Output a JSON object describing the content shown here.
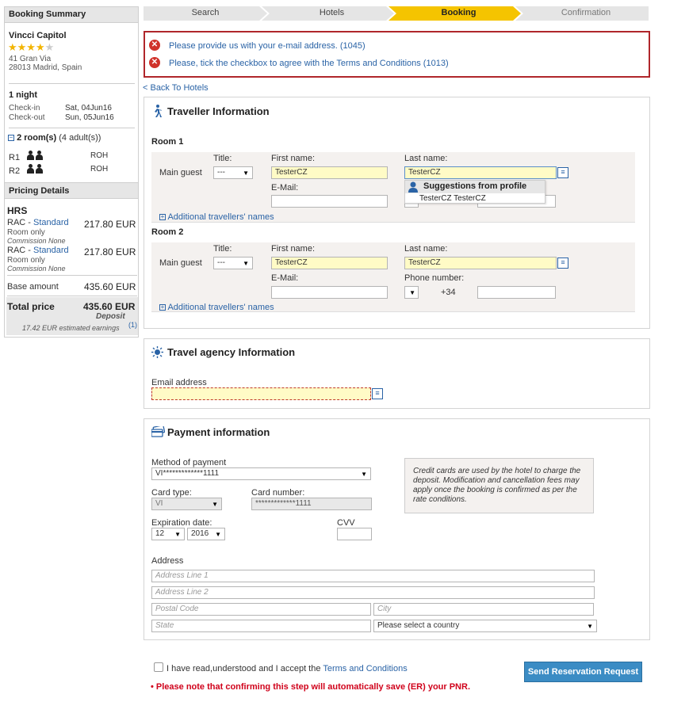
{
  "steps": [
    "Search",
    "Hotels",
    "Booking",
    "Confirmation"
  ],
  "summary": {
    "title": "Booking Summary",
    "hotel_name": "Vincci Capitol",
    "stars": "★★★★",
    "star_empty": "★",
    "address1": "41 Gran Via",
    "address2": "28013 Madrid, Spain",
    "nights": "1 night",
    "checkin_label": "Check-in",
    "checkin_value": "Sat, 04Jun16",
    "checkout_label": "Check-out",
    "checkout_value": "Sun, 05Jun16",
    "rooms_label": "2 room(s)",
    "rooms_adults": "(4 adult(s))",
    "rooms": [
      {
        "id": "R1",
        "code": "ROH"
      },
      {
        "id": "R2",
        "code": "ROH"
      }
    ]
  },
  "pricing": {
    "title": "Pricing Details",
    "provider": "HRS",
    "rates": [
      {
        "code": "RAC",
        "sep": " - ",
        "type": "Standard",
        "board": "Room only",
        "commission": "Commission None",
        "price": "217.80 EUR"
      },
      {
        "code": "RAC",
        "sep": " - ",
        "type": "Standard",
        "board": "Room only",
        "commission": "Commission None",
        "price": "217.80 EUR"
      }
    ],
    "base_label": "Base amount",
    "base_value": "435.60 EUR",
    "total_label": "Total price",
    "total_value": "435.60 EUR",
    "deposit": "Deposit",
    "earnings": "17.42 EUR estimated earnings",
    "earnings_note": "(1)"
  },
  "errors": [
    "Please provide us with your e-mail address. (1045)",
    "Please, tick the checkbox to agree with the Terms and Conditions (1013)"
  ],
  "back_link": "< Back To Hotels",
  "traveller": {
    "title": "Traveller Information",
    "main_guest": "Main guest",
    "title_label": "Title:",
    "first_label": "First name:",
    "last_label": "Last name:",
    "email_label": "E-Mail:",
    "phone_label": "Phone number:",
    "title_value": "---",
    "phone_code": "+34",
    "additional": "Additional travellers' names",
    "rooms": [
      {
        "label": "Room 1",
        "first": "TesterCZ",
        "last": "TesterCZ"
      },
      {
        "label": "Room 2",
        "first": "TesterCZ",
        "last": "TesterCZ"
      }
    ],
    "suggest_header": "Suggestions from profile",
    "suggest_item": "TesterCZ TesterCZ"
  },
  "agency": {
    "title": "Travel agency Information",
    "email_label": "Email address"
  },
  "payment": {
    "title": "Payment information",
    "method_label": "Method of payment",
    "method_value": "VI*************1111",
    "card_type_label": "Card type:",
    "card_type_value": "VI",
    "card_number_label": "Card number:",
    "card_number_value": "*************1111",
    "expiry_label": "Expiration date:",
    "exp_month": "12",
    "exp_year": "2016",
    "cvv_label": "CVV",
    "note": "Credit cards are used by the hotel to charge the deposit. Modification and cancellation fees may apply once the booking is confirmed as per the rate conditions.",
    "address_label": "Address",
    "addr1_ph": "Address Line 1",
    "addr2_ph": "Address Line 2",
    "postal_ph": "Postal Code",
    "city_ph": "City",
    "state_ph": "State",
    "country_value": "Please select a country"
  },
  "footer": {
    "accept_text": "I have read,understood and I accept the ",
    "terms_link": "Terms and Conditions",
    "send_button": "Send Reservation Request",
    "warning": "• Please note that confirming this step will automatically save (ER) your PNR."
  },
  "colors": {
    "active_step": "#f5c400",
    "link": "#2a63a6",
    "error_border": "#b0262b",
    "field_highlight": "#fffbc6",
    "button": "#3b8cc4"
  }
}
